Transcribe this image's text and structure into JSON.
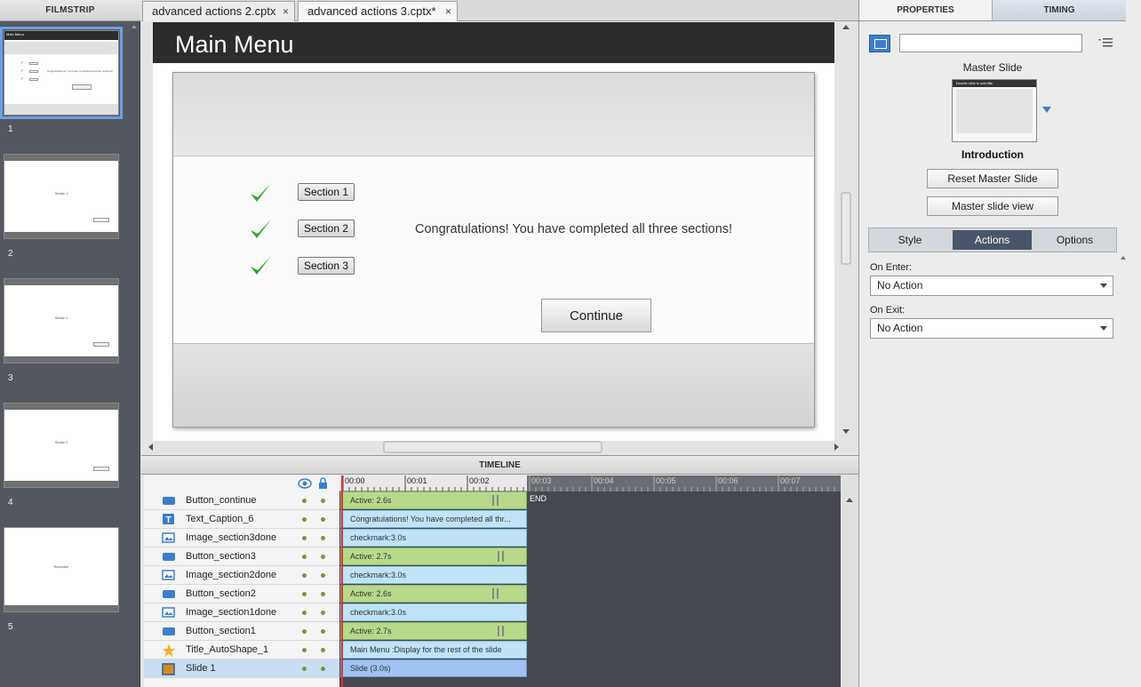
{
  "filmstrip": {
    "title": "FILMSTRIP",
    "slides": [
      {
        "number": "1",
        "selected": true
      },
      {
        "number": "2",
        "text": "Section 1"
      },
      {
        "number": "3",
        "text": "Section 2"
      },
      {
        "number": "4",
        "text": "Section 3"
      },
      {
        "number": "5",
        "text": "Resolution"
      }
    ]
  },
  "tabs": [
    {
      "label": "advanced actions 2.cptx",
      "close": "×"
    },
    {
      "label": "advanced actions 3.cptx*",
      "close": "×"
    }
  ],
  "slide": {
    "title": "Main Menu",
    "section_buttons": [
      "Section 1",
      "Section 2",
      "Section 3"
    ],
    "congrats": "Congratulations! You have completed all three sections!",
    "continue": "Continue"
  },
  "timeline": {
    "title": "TIMELINE",
    "ticks": [
      "00:00",
      "00:01",
      "00:02",
      "00:03",
      "00:04",
      "00:05",
      "00:06",
      "00:07"
    ],
    "end_label": "END",
    "layers": [
      {
        "name": "Button_continue",
        "icon": "button-icon",
        "bar": "Active: 2.6s",
        "bar_type": "green",
        "pause": true
      },
      {
        "name": "Text_Caption_6",
        "icon": "text-caption-icon",
        "bar": "Congratulations! You have completed all thr...",
        "bar_type": "blue",
        "pause": false
      },
      {
        "name": "Image_section3done",
        "icon": "image-icon",
        "bar": "checkmark:3.0s",
        "bar_type": "blue",
        "pause": false
      },
      {
        "name": "Button_section3",
        "icon": "button-icon",
        "bar": "Active: 2.7s",
        "bar_type": "green",
        "pause": true
      },
      {
        "name": "Image_section2done",
        "icon": "image-icon",
        "bar": "checkmark:3.0s",
        "bar_type": "blue",
        "pause": false
      },
      {
        "name": "Button_section2",
        "icon": "button-icon",
        "bar": "Active: 2.6s",
        "bar_type": "green",
        "pause": true
      },
      {
        "name": "Image_section1done",
        "icon": "image-icon",
        "bar": "checkmark:3.0s",
        "bar_type": "blue",
        "pause": false
      },
      {
        "name": "Button_section1",
        "icon": "button-icon",
        "bar": "Active: 2.7s",
        "bar_type": "green",
        "pause": true
      },
      {
        "name": "Title_AutoShape_1",
        "icon": "star-icon",
        "bar": "Main Menu :Display for the rest of the slide",
        "bar_type": "blue",
        "pause": false
      },
      {
        "name": "Slide 1",
        "icon": "slide-icon",
        "bar": "Slide (3.0s)",
        "bar_type": "slide",
        "pause": false
      }
    ]
  },
  "properties": {
    "tab_properties": "PROPERTIES",
    "tab_timing": "TIMING",
    "name_value": "",
    "master_slide_label": "Master Slide",
    "master_thumb_text": "Double click to add title",
    "master_name": "Introduction",
    "reset_master": "Reset Master Slide",
    "master_view": "Master slide view",
    "subtabs": [
      "Style",
      "Actions",
      "Options"
    ],
    "active_subtab": "Actions",
    "on_enter_label": "On Enter:",
    "on_enter_value": "No Action",
    "on_exit_label": "On Exit:",
    "on_exit_value": "No Action"
  },
  "colors": {
    "accent": "#3c7ecb",
    "check_green": "#2ea82e",
    "slide_title_bar": "#2c2c2c"
  }
}
